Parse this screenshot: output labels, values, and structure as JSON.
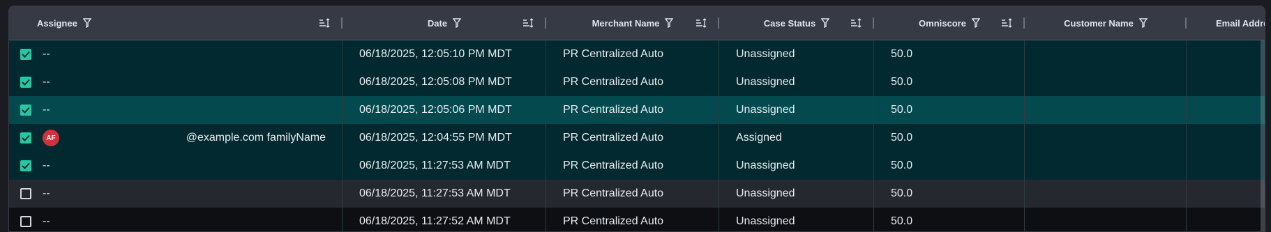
{
  "columns": [
    {
      "label": "Assignee",
      "filter_icon": "filter-icon",
      "sort_icon": "sort-icon"
    },
    {
      "label": "Date",
      "filter_icon": "filter-icon",
      "sort_icon": "sort-icon"
    },
    {
      "label": "Merchant Name",
      "filter_icon": "filter-icon",
      "sort_icon": "sort-icon"
    },
    {
      "label": "Case Status",
      "filter_icon": "filter-icon",
      "sort_icon": "sort-icon"
    },
    {
      "label": "Omniscore",
      "filter_icon": "filter-icon",
      "sort_icon": "sort-icon"
    },
    {
      "label": "Customer Name",
      "filter_icon": "filter-icon"
    },
    {
      "label": "Email Addre"
    }
  ],
  "rows": [
    {
      "checked": true,
      "assignee": "--",
      "date": "06/18/2025, 12:05:10 PM MDT",
      "merchant": "PR Centralized Auto",
      "status": "Unassigned",
      "omniscore": "50.0",
      "customer": ""
    },
    {
      "checked": true,
      "assignee": "--",
      "date": "06/18/2025, 12:05:08 PM MDT",
      "merchant": "PR Centralized Auto",
      "status": "Unassigned",
      "omniscore": "50.0",
      "customer": ""
    },
    {
      "checked": true,
      "assignee": "--",
      "date": "06/18/2025, 12:05:06 PM MDT",
      "merchant": "PR Centralized Auto",
      "status": "Unassigned",
      "omniscore": "50.0",
      "customer": "",
      "hovered": true
    },
    {
      "checked": true,
      "assignee": "@example.com familyName",
      "avatar_initials": "AF",
      "date": "06/18/2025, 12:04:55 PM MDT",
      "merchant": "PR Centralized Auto",
      "status": "Assigned",
      "omniscore": "50.0",
      "customer": ""
    },
    {
      "checked": true,
      "assignee": "--",
      "date": "06/18/2025, 11:27:53 AM MDT",
      "merchant": "PR Centralized Auto",
      "status": "Unassigned",
      "omniscore": "50.0",
      "customer": ""
    },
    {
      "checked": false,
      "assignee": "--",
      "date": "06/18/2025, 11:27:53 AM MDT",
      "merchant": "PR Centralized Auto",
      "status": "Unassigned",
      "omniscore": "50.0",
      "customer": ""
    },
    {
      "checked": false,
      "assignee": "--",
      "date": "06/18/2025, 11:27:52 AM MDT",
      "merchant": "PR Centralized Auto",
      "status": "Unassigned",
      "omniscore": "50.0",
      "customer": ""
    }
  ],
  "colors": {
    "selected_row": "#02292f",
    "hovered_row": "#03494e",
    "checkbox_checked": "#27c7a2",
    "avatar": "#d0313a",
    "header": "#363a45"
  }
}
